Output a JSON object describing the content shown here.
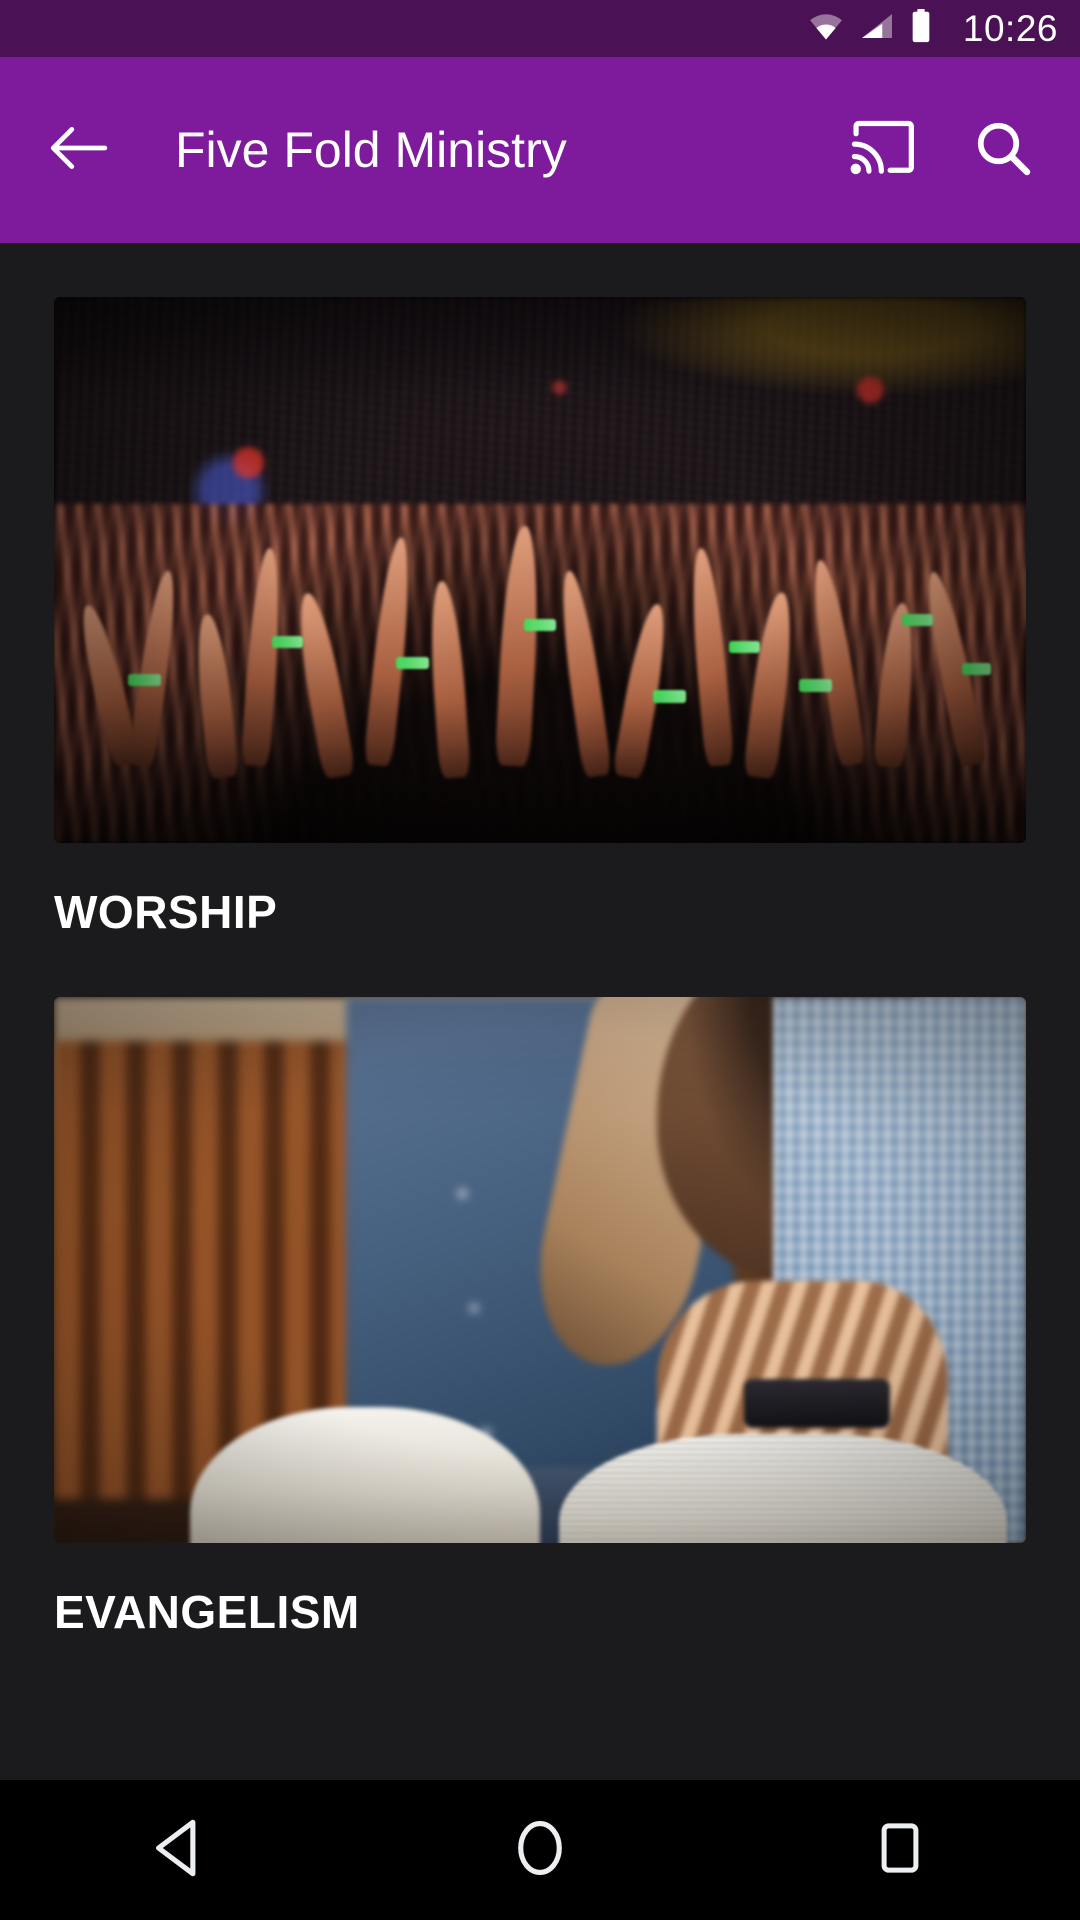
{
  "status_bar": {
    "wifi_icon": "wifi-icon",
    "signal_icon": "cellular-signal-icon",
    "battery_icon": "battery-full-icon",
    "clock": "10:26",
    "background_color": "#4a1154"
  },
  "app_bar": {
    "back_icon": "arrow-back-icon",
    "title": "Five Fold Ministry",
    "cast_icon": "cast-icon",
    "search_icon": "search-icon",
    "background_color": "#7e1a9c",
    "text_color": "#ffffff"
  },
  "content": {
    "background_color": "#1b1b1d",
    "cards": [
      {
        "title": "WORSHIP",
        "image_name": "worship-crowd-raised-hands-photo"
      },
      {
        "title": "EVANGELISM",
        "image_name": "evangelism-men-praying-bible-photo"
      }
    ]
  },
  "nav_bar": {
    "background_color": "#000000",
    "buttons": [
      {
        "name": "back-nav-button",
        "icon": "triangle-back-icon"
      },
      {
        "name": "home-nav-button",
        "icon": "circle-home-icon"
      },
      {
        "name": "recents-nav-button",
        "icon": "square-recents-icon"
      }
    ]
  }
}
